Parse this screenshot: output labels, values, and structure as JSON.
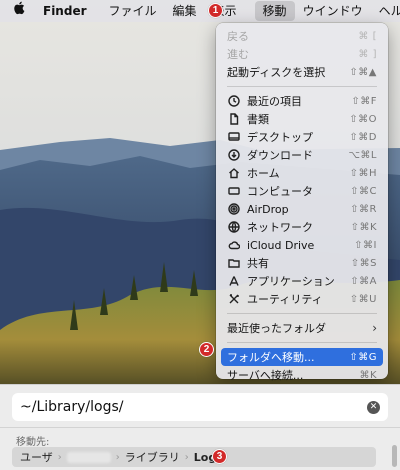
{
  "menubar": {
    "apple": "apple-icon",
    "items": [
      {
        "label": "Finder"
      },
      {
        "label": "ファイル"
      },
      {
        "label": "編集"
      },
      {
        "label": "表示"
      },
      {
        "label": "移動"
      },
      {
        "label": "ウインドウ"
      },
      {
        "label": "ヘルプ"
      }
    ]
  },
  "badges": [
    "1",
    "2",
    "3"
  ],
  "menu": {
    "items": [
      {
        "label": "戻る",
        "shortcut": "⌘ [",
        "disabled": true,
        "icon": ""
      },
      {
        "label": "進む",
        "shortcut": "⌘ ]",
        "disabled": true,
        "icon": ""
      },
      {
        "label": "起動ディスクを選択",
        "shortcut": "⇧⌘▲",
        "disabled": false,
        "icon": ""
      },
      {
        "label": "最近の項目",
        "shortcut": "⇧⌘F",
        "icon": "clock-icon"
      },
      {
        "label": "書類",
        "shortcut": "⇧⌘O",
        "icon": "document-icon"
      },
      {
        "label": "デスクトップ",
        "shortcut": "⇧⌘D",
        "icon": "desktop-icon"
      },
      {
        "label": "ダウンロード",
        "shortcut": "⌥⌘L",
        "icon": "download-icon"
      },
      {
        "label": "ホーム",
        "shortcut": "⇧⌘H",
        "icon": "home-icon"
      },
      {
        "label": "コンピュータ",
        "shortcut": "⇧⌘C",
        "icon": "computer-icon"
      },
      {
        "label": "AirDrop",
        "shortcut": "⇧⌘R",
        "icon": "airdrop-icon"
      },
      {
        "label": "ネットワーク",
        "shortcut": "⇧⌘K",
        "icon": "network-icon"
      },
      {
        "label": "iCloud Drive",
        "shortcut": "⇧⌘I",
        "icon": "cloud-icon"
      },
      {
        "label": "共有",
        "shortcut": "⇧⌘S",
        "icon": "shared-folder-icon"
      },
      {
        "label": "アプリケーション",
        "shortcut": "⇧⌘A",
        "icon": "applications-icon"
      },
      {
        "label": "ユーティリティ",
        "shortcut": "⇧⌘U",
        "icon": "utilities-icon"
      },
      {
        "label": "最近使ったフォルダ",
        "shortcut": "›",
        "icon": ""
      },
      {
        "label": "フォルダへ移動...",
        "shortcut": "⇧⌘G",
        "icon": ""
      },
      {
        "label": "サーバへ接続...",
        "shortcut": "⌘K",
        "icon": ""
      }
    ]
  },
  "goto": {
    "path": "~/Library/logs/",
    "dest_label": "移動先:",
    "crumbs": [
      "ユーザ",
      "ライブラリ",
      "Logs"
    ]
  },
  "colors": {
    "highlight": "#2f6fde",
    "badge": "#d22a2a"
  }
}
